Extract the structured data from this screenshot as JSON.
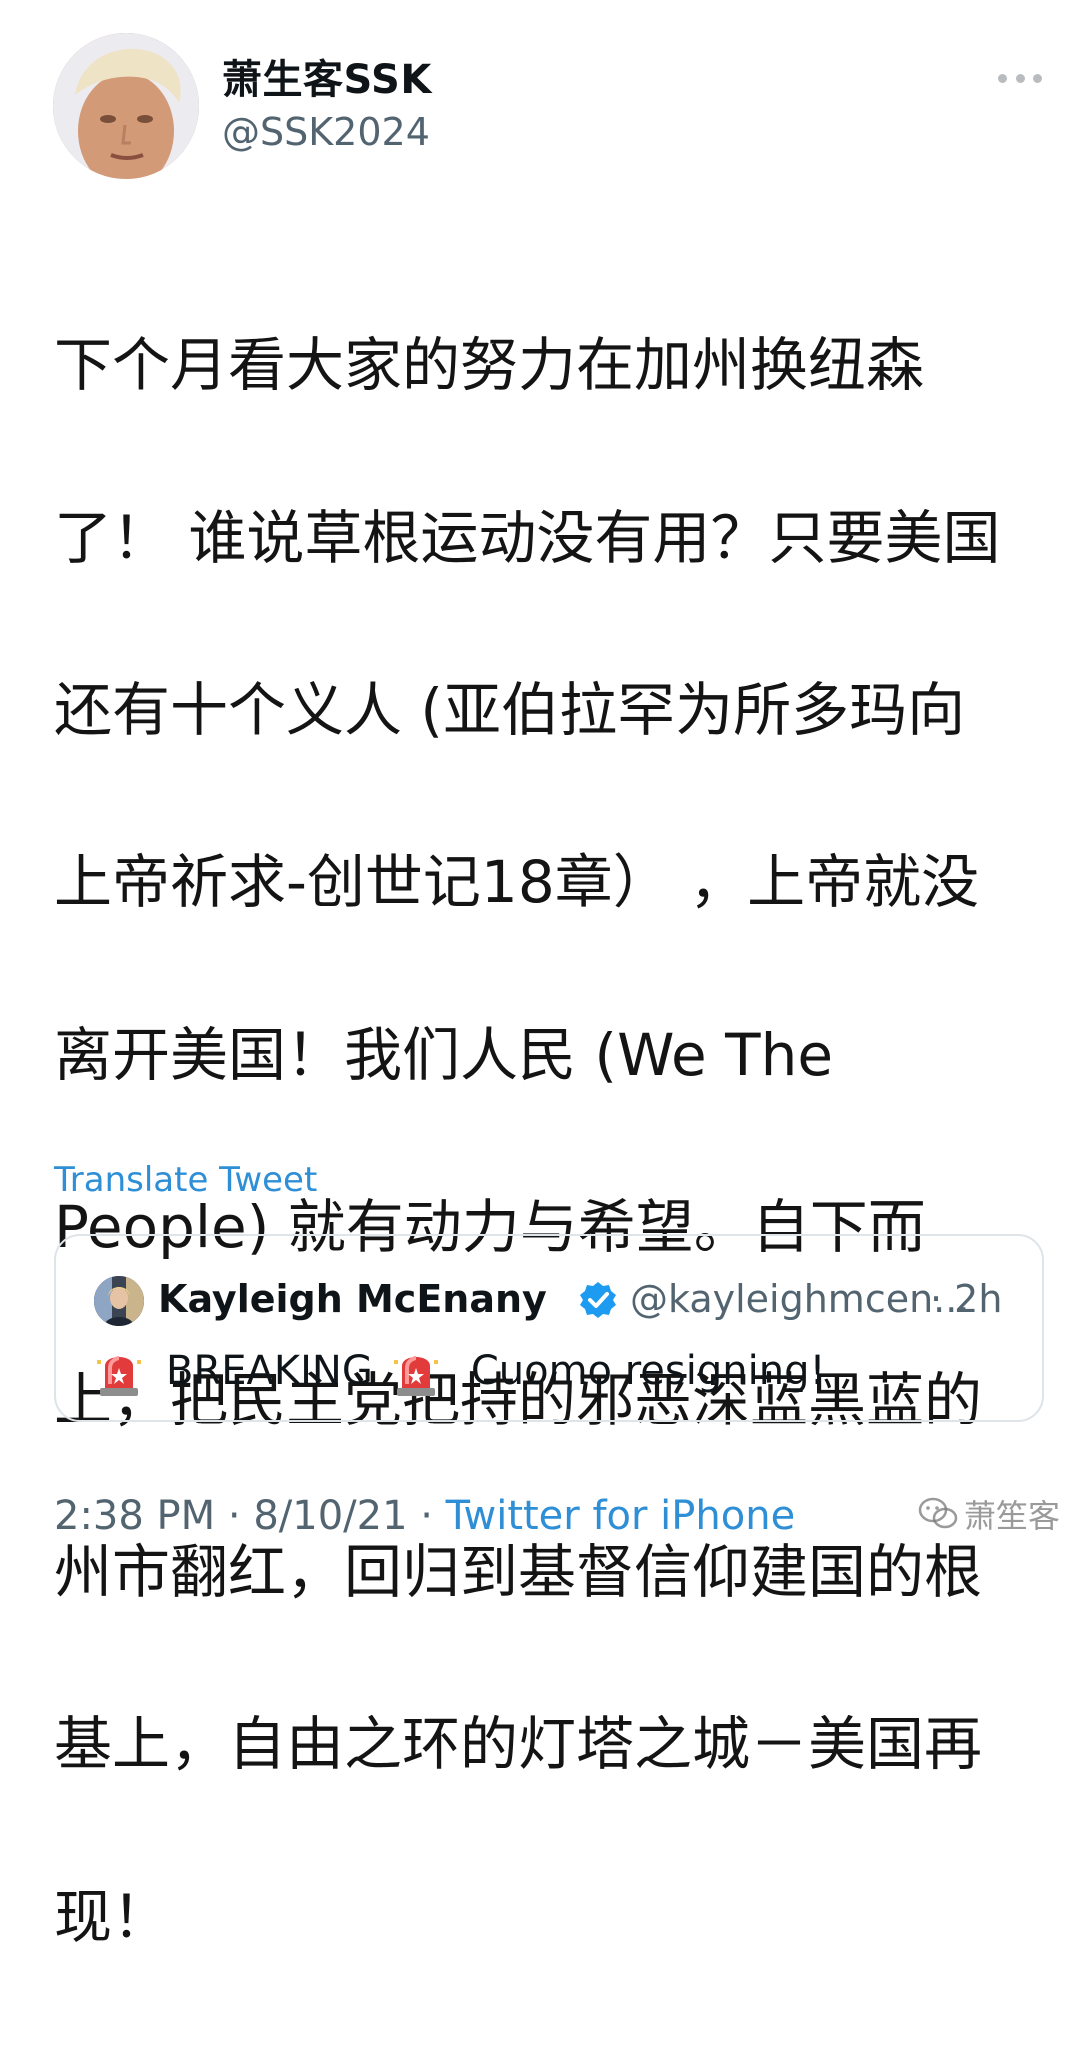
{
  "author": {
    "display_name": "萧生客SSK",
    "handle": "@SSK2024"
  },
  "tweet": {
    "text_lines": [
      "下个月看大家的努力在加州换纽森",
      "了！ 谁说草根运动没有用？只要美国",
      "还有十个义人 (亚伯拉罕为所多玛向",
      "上帝祈求-创世记18章） ，上帝就没",
      "离开美国！我们人民 (We The",
      "People) 就有动力与希望。自下而",
      "上，把民主党把持的邪恶深蓝黑蓝的",
      "州市翻红，回归到基督信仰建国的根",
      "基上，自由之环的灯塔之城－美国再",
      "现！"
    ],
    "translate_label": "Translate Tweet"
  },
  "quote": {
    "name": "Kayleigh McEnany",
    "handle": "@kayleighmcen...",
    "time": "· 2h",
    "word1": "BREAKING",
    "word2": "Cuomo resigning!"
  },
  "footer": {
    "time": "2:38 PM · 8/10/21 · ",
    "source": "Twitter for iPhone"
  },
  "watermark": {
    "text": "萧笙客"
  },
  "colors": {
    "link": "#2f8fd6",
    "secondary_text": "#536471",
    "verified": "#1d9bf0",
    "border": "#dfe4e8"
  },
  "icons": {
    "more": "more-dots-icon",
    "verified": "verified-badge-icon",
    "siren": "siren-emoji-icon",
    "watermark": "wechat-icon"
  }
}
